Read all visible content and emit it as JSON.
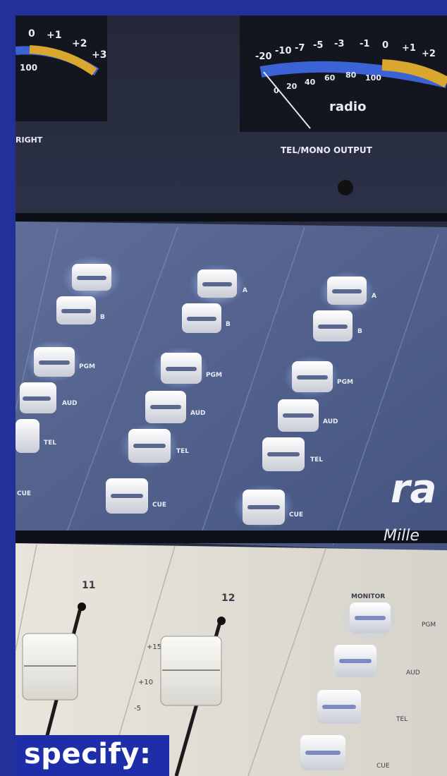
{
  "caption": {
    "text": "specify:"
  },
  "meters": {
    "left": {
      "scale": [
        "0",
        "+1",
        "+2",
        "+3"
      ],
      "pct": "100",
      "label": "RIGHT"
    },
    "right": {
      "scale_db": [
        "-20",
        "-10",
        "-7",
        "-5",
        "-3",
        "-1",
        "0",
        "+1",
        "+2"
      ],
      "scale_pct": [
        "0",
        "20",
        "40",
        "60",
        "80",
        "100"
      ],
      "brand": "radio",
      "label": "TEL/MONO  OUTPUT"
    }
  },
  "channel_buttons": {
    "a": "A",
    "b": "B",
    "pgm": "PGM",
    "aud": "AUD",
    "tel": "TEL",
    "cue": "CUE"
  },
  "faders": {
    "ch11": "11",
    "ch12": "12",
    "marks": [
      "+15",
      "+10",
      "-5"
    ]
  },
  "monitor_section": {
    "title": "MONITOR",
    "buttons": [
      "PGM",
      "AUD",
      "TEL",
      "CUE"
    ]
  },
  "logo": {
    "brand": "ra",
    "sub": "Mille"
  },
  "colors": {
    "border": "#22309a",
    "caption_bg": "#1d2ea8",
    "panel": "#4a5a86",
    "meter_gold": "#d9a62e",
    "meter_blue": "#3b63d6"
  }
}
